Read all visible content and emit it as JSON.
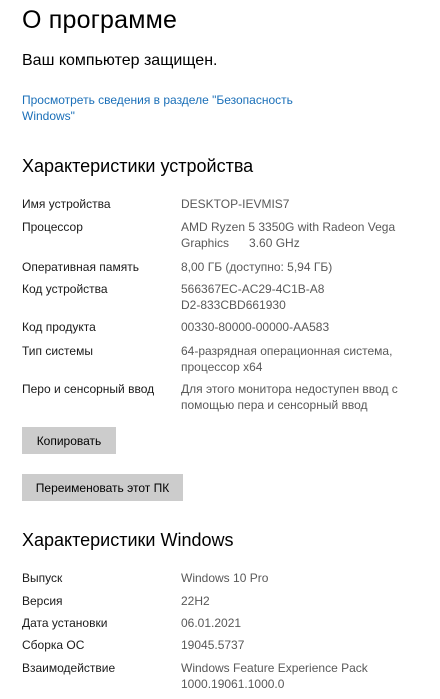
{
  "page": {
    "title": "О программе",
    "protected_status": "Ваш компьютер защищен.",
    "security_link": "Просмотреть сведения в разделе \"Безопасность Windows\""
  },
  "device": {
    "heading": "Характеристики устройства",
    "rows": [
      {
        "label": "Имя устройства",
        "value": "DESKTOP-IEVMIS7"
      },
      {
        "label": "Процессор",
        "value": "AMD Ryzen 5 3350G with Radeon Vega Graphics      3.60 GHz"
      },
      {
        "label": "Оперативная память",
        "value": "8,00 ГБ (доступно: 5,94 ГБ)"
      },
      {
        "label": "Код устройства",
        "value": "566367EC-AC29-4C1B-A8D2-833CBD661930"
      },
      {
        "label": "Код продукта",
        "value": "00330-80000-00000-AA583"
      },
      {
        "label": "Тип системы",
        "value": "64-разрядная операционная система, процессор x64"
      },
      {
        "label": "Перо и сенсорный ввод",
        "value": "Для этого монитора недоступен ввод с помощью пера и сенсорный ввод"
      }
    ],
    "copy_button": "Копировать",
    "rename_button": "Переименовать этот ПК"
  },
  "windows": {
    "heading": "Характеристики Windows",
    "rows": [
      {
        "label": "Выпуск",
        "value": "Windows 10 Pro"
      },
      {
        "label": "Версия",
        "value": "22H2"
      },
      {
        "label": "Дата установки",
        "value": "06.01.2021"
      },
      {
        "label": "Сборка ОС",
        "value": "19045.5737"
      },
      {
        "label": "Взаимодействие",
        "value": "Windows Feature Experience Pack 1000.19061.1000.0"
      }
    ]
  },
  "colors": {
    "link": "#1a6fb8",
    "value_text": "#595959",
    "button_bg": "#cccccc"
  }
}
